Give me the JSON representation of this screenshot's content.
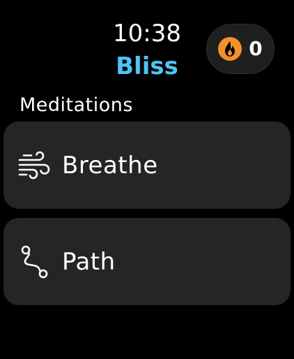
{
  "status": {
    "time": "10:38"
  },
  "app": {
    "title": "Bliss",
    "title_color": "#4fc3f7"
  },
  "streak": {
    "icon": "flame-icon",
    "icon_color": "#f0912e",
    "count": "0"
  },
  "section": {
    "title": "Meditations"
  },
  "meditations": [
    {
      "label": "Breathe",
      "icon": "wind-icon"
    },
    {
      "label": "Path",
      "icon": "path-icon"
    }
  ]
}
